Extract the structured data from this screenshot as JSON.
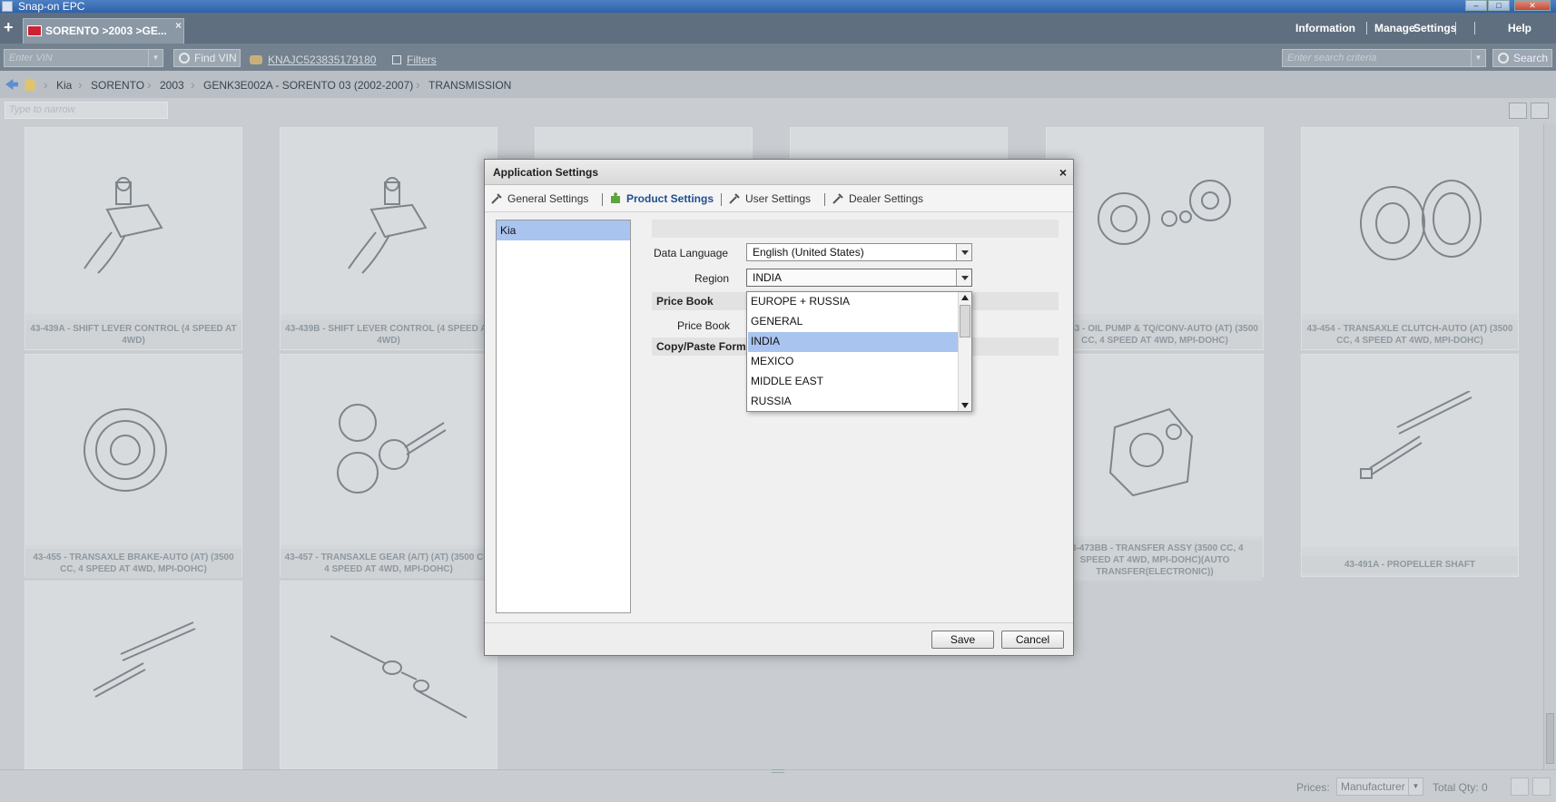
{
  "window": {
    "title": "Snap-on EPC"
  },
  "tabbar": {
    "tab_label": "SORENTO >2003 >GE...",
    "tab_close": "×",
    "add": "+",
    "menu": [
      "Information",
      "Manage",
      "Settings",
      "Help"
    ]
  },
  "toolbar": {
    "vin_placeholder": "Enter VIN",
    "find_vin": "Find VIN",
    "vin_link": "KNAJC523835179180",
    "filters": "Filters",
    "search_placeholder": "Enter search criteria",
    "search_label": "Search"
  },
  "breadcrumb": [
    "Kia",
    "SORENTO",
    "2003",
    "GENK3E002A - SORENTO 03 (2002-2007)",
    "TRANSMISSION"
  ],
  "narrow_placeholder": "Type to narrow",
  "cards": [
    {
      "caption": "43-439A - SHIFT LEVER CONTROL (4 SPEED AT 4WD)"
    },
    {
      "caption": "43-439B - SHIFT LEVER CONTROL (4 SPEED AT 4WD)"
    },
    {
      "caption": ""
    },
    {
      "caption": ""
    },
    {
      "caption": "43-453 - OIL PUMP & TQ/CONV-AUTO (AT) (3500 CC, 4 SPEED AT 4WD, MPI-DOHC)"
    },
    {
      "caption": "43-454 - TRANSAXLE CLUTCH-AUTO (AT) (3500 CC, 4 SPEED AT 4WD, MPI-DOHC)"
    },
    {
      "caption": "43-455 - TRANSAXLE BRAKE-AUTO (AT) (3500 CC, 4 SPEED AT 4WD, MPI-DOHC)"
    },
    {
      "caption": "43-457 - TRANSAXLE GEAR (A/T) (AT) (3500 CC, 4 SPEED AT 4WD, MPI-DOHC)"
    },
    {
      "caption": "43-473BB - TRANSFER ASSY (3500 CC, 4 SPEED AT 4WD, MPI-DOHC)(AUTO TRANSFER(ELECTRONIC))"
    },
    {
      "caption": "43-491A - PROPELLER SHAFT"
    },
    {
      "caption": ""
    },
    {
      "caption": ""
    }
  ],
  "status": {
    "prices_label": "Prices:",
    "prices_value": "Manufacturer",
    "total_qty": "Total Qty: 0"
  },
  "modal": {
    "title": "Application Settings",
    "close": "×",
    "tabs": [
      "General Settings",
      "Product Settings",
      "User Settings",
      "Dealer Settings"
    ],
    "active_tab": "Product Settings",
    "products": [
      "Kia"
    ],
    "data_language_label": "Data Language",
    "data_language_value": "English (United States)",
    "region_label": "Region",
    "region_value": "INDIA",
    "price_book_section": "Price Book",
    "price_book_label": "Price Book",
    "copy_paste_section": "Copy/Paste Forma",
    "region_options": [
      "EUROPE + RUSSIA",
      "GENERAL",
      "INDIA",
      "MEXICO",
      "MIDDLE EAST",
      "RUSSIA"
    ],
    "region_selected_index": 2,
    "save": "Save",
    "cancel": "Cancel"
  },
  "colors": {
    "accent": "#1f4f8f",
    "selection": "#a9c4ee",
    "titlebar": "#2f62a8"
  }
}
